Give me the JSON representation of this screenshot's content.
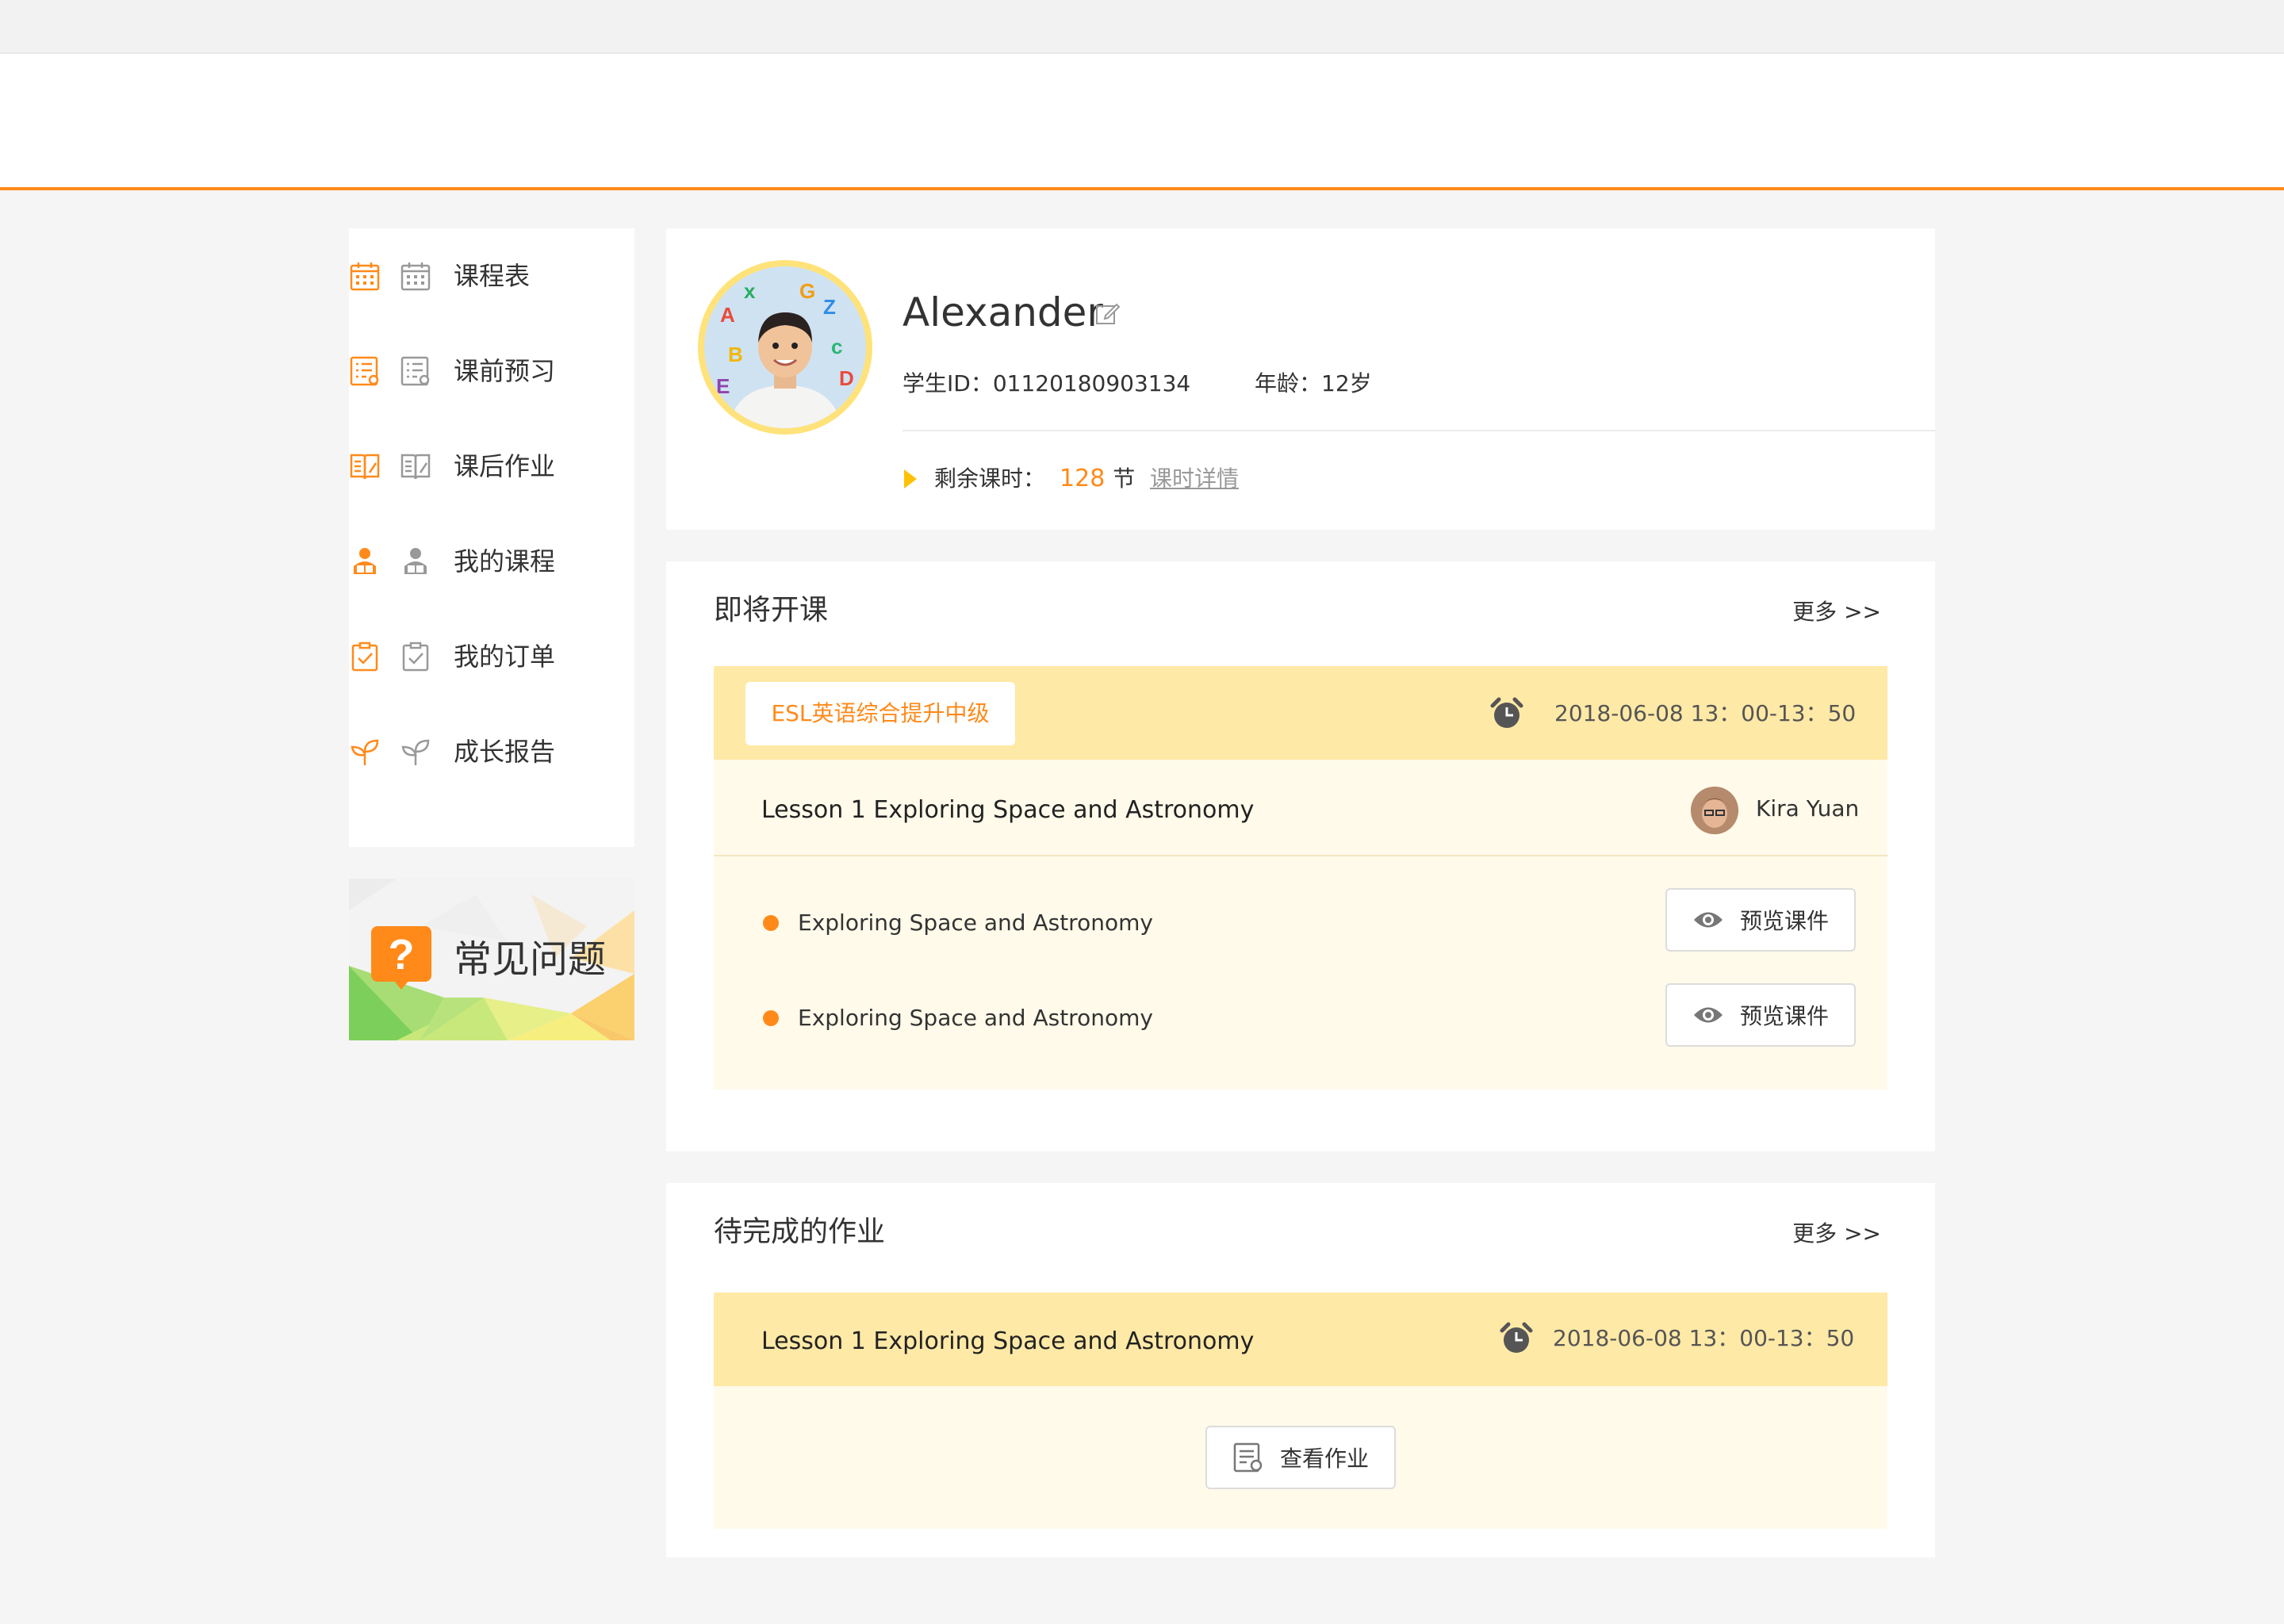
{
  "sidebar": {
    "items": [
      {
        "label": "课程表",
        "icon": "calendar-icon"
      },
      {
        "label": "课前预习",
        "icon": "preview-list-icon"
      },
      {
        "label": "课后作业",
        "icon": "book-edit-icon"
      },
      {
        "label": "我的课程",
        "icon": "student-icon"
      },
      {
        "label": "我的订单",
        "icon": "clipboard-check-icon"
      },
      {
        "label": "成长报告",
        "icon": "sprout-icon"
      }
    ],
    "faq_label": "常见问题"
  },
  "profile": {
    "name": "Alexander",
    "student_id": "学生ID：01120180903134",
    "age": "年龄：12岁",
    "remaining_label": "剩余课时：",
    "remaining_value": "128",
    "remaining_unit": "节",
    "detail_link": "课时详情"
  },
  "upcoming": {
    "title": "即将开课",
    "more": "更多 >>",
    "course_tag": "ESL英语综合提升中级",
    "time": "2018-06-08  13：00-13：50",
    "lesson_title": "Lesson 1 Exploring Space and Astronomy",
    "teacher": "Kira Yuan",
    "materials": [
      {
        "name": "Exploring Space and Astronomy",
        "button": "预览课件"
      },
      {
        "name": "Exploring Space and Astronomy",
        "button": "预览课件"
      }
    ]
  },
  "homework": {
    "title": "待完成的作业",
    "more": "更多 >>",
    "lesson_title": "Lesson 1 Exploring Space and Astronomy",
    "time": "2018-06-08  13：00-13：50",
    "button": "查看作业"
  },
  "colors": {
    "accent": "#ff8a1a",
    "card_head": "#ffe9a6",
    "card_body": "#fffaea",
    "avatar_ring": "#ffe27a"
  }
}
